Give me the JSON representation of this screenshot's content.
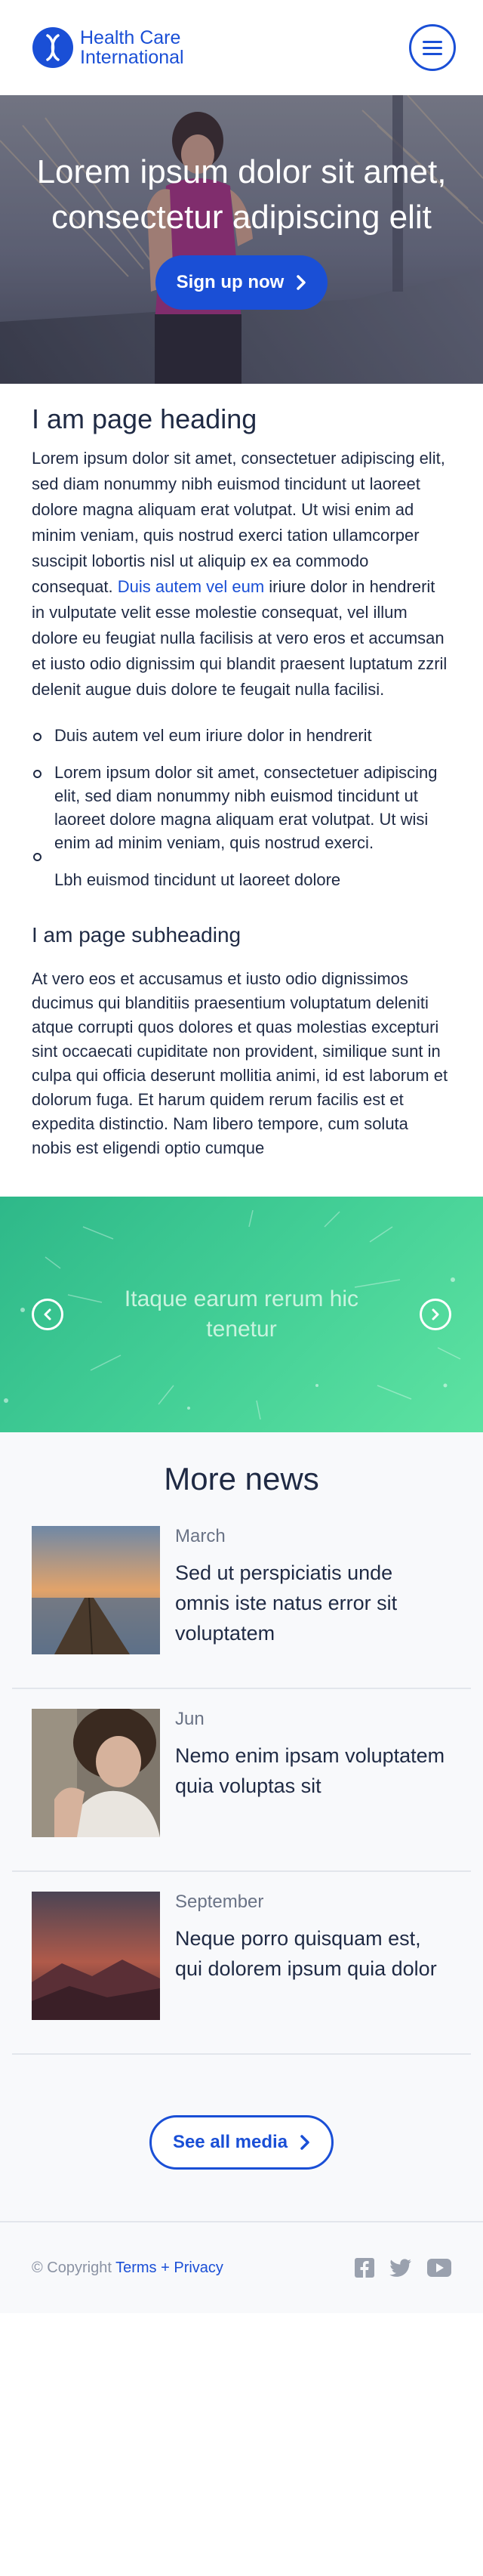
{
  "header": {
    "logo_line1": "Health Care",
    "logo_line2": "International",
    "menu_icon": "hamburger-icon"
  },
  "hero": {
    "title": "Lorem ipsum dolor sit amet, consectetur adipiscing elit",
    "cta_label": "Sign up now"
  },
  "article": {
    "heading": "I am page heading",
    "paragraph_before_link": "Lorem ipsum dolor sit amet, consectetuer adipiscing elit, sed diam nonummy nibh euismod tincidunt ut laoreet dolore magna aliquam erat volutpat. Ut wisi enim ad minim veniam, quis nostrud exerci tation ullamcorper suscipit lobortis nisl ut aliquip ex ea commodo consequat. ",
    "paragraph_link": "Duis autem vel eum",
    "paragraph_after_link": " iriure dolor in hendrerit in vulputate velit esse molestie consequat, vel illum dolore eu feugiat nulla facilisis at vero eros et accumsan et iusto odio dignissim qui blandit praesent luptatum zzril delenit augue duis dolore te feugait nulla facilisi.",
    "bullets": [
      "Duis autem vel eum iriure dolor in hendrerit",
      "Lorem ipsum dolor sit amet, consectetuer adipiscing elit, sed diam nonummy nibh euismod tincidunt ut laoreet dolore magna aliquam erat volutpat. Ut wisi enim ad minim veniam, quis nostrud exerci.",
      "Lbh euismod tincidunt ut laoreet dolore"
    ],
    "subheading": "I am page subheading",
    "paragraph2": "At vero eos et accusamus et iusto odio dignissimos ducimus qui blanditiis praesentium voluptatum deleniti atque corrupti quos dolores et quas molestias excepturi sint occaecati cupiditate non provident, similique sunt in culpa qui officia deserunt mollitia animi, id est laborum et dolorum fuga. Et harum quidem rerum facilis est et expedita distinctio. Nam libero tempore, cum soluta nobis est eligendi optio cumque"
  },
  "carousel": {
    "text": "Itaque earum rerum hic tenetur",
    "prev_icon": "chevron-left-icon",
    "next_icon": "chevron-right-icon",
    "color": "#43cf96"
  },
  "news": {
    "heading": "More news",
    "items": [
      {
        "month": "March",
        "title": "Sed ut perspiciatis unde omnis iste natus error sit voluptatem"
      },
      {
        "month": "Jun",
        "title": "Nemo enim ipsam voluptatem quia voluptas sit"
      },
      {
        "month": "September",
        "title": "Neque porro quisquam est, qui dolorem ipsum quia dolor"
      }
    ],
    "see_all_label": "See all media"
  },
  "footer": {
    "copyright": "© Copyright",
    "terms": "Terms",
    "plus": "+",
    "privacy": "Privacy",
    "socials": [
      "facebook-icon",
      "twitter-icon",
      "youtube-icon"
    ]
  },
  "colors": {
    "brand": "#1a4fd6",
    "text": "#1f2a44",
    "muted": "#8a92a3"
  }
}
